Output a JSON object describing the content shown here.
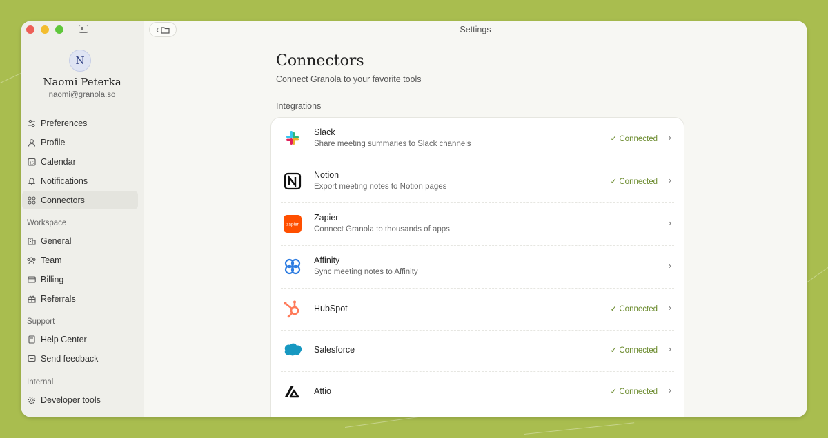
{
  "window": {
    "title": "Settings"
  },
  "user": {
    "initial": "N",
    "name": "Naomi Peterka",
    "email": "naomi@granola.so"
  },
  "sidebar": {
    "main_items": [
      {
        "label": "Preferences",
        "icon": "sliders-icon"
      },
      {
        "label": "Profile",
        "icon": "person-icon"
      },
      {
        "label": "Calendar",
        "icon": "calendar-icon"
      },
      {
        "label": "Notifications",
        "icon": "bell-icon"
      },
      {
        "label": "Connectors",
        "icon": "connectors-icon",
        "active": true
      }
    ],
    "workspace_label": "Workspace",
    "workspace_items": [
      {
        "label": "General",
        "icon": "building-icon"
      },
      {
        "label": "Team",
        "icon": "team-icon"
      },
      {
        "label": "Billing",
        "icon": "card-icon"
      },
      {
        "label": "Referrals",
        "icon": "gift-icon"
      }
    ],
    "support_label": "Support",
    "support_items": [
      {
        "label": "Help Center",
        "icon": "book-icon"
      },
      {
        "label": "Send feedback",
        "icon": "feedback-icon"
      }
    ],
    "internal_label": "Internal",
    "internal_items": [
      {
        "label": "Developer tools",
        "icon": "gear-icon"
      }
    ]
  },
  "page": {
    "title": "Connectors",
    "subtitle": "Connect Granola to your favorite tools",
    "section_label": "Integrations"
  },
  "integrations": [
    {
      "name": "Slack",
      "description": "Share meeting summaries to Slack channels",
      "status": "Connected",
      "icon": "slack-icon"
    },
    {
      "name": "Notion",
      "description": "Export meeting notes to Notion pages",
      "status": "Connected",
      "icon": "notion-icon"
    },
    {
      "name": "Zapier",
      "description": "Connect Granola to thousands of apps",
      "status": "",
      "icon": "zapier-icon"
    },
    {
      "name": "Affinity",
      "description": "Sync meeting notes to Affinity",
      "status": "",
      "icon": "affinity-icon"
    },
    {
      "name": "HubSpot",
      "description": "",
      "status": "Connected",
      "icon": "hubspot-icon"
    },
    {
      "name": "Salesforce",
      "description": "",
      "status": "Connected",
      "icon": "salesforce-icon"
    },
    {
      "name": "Attio",
      "description": "",
      "status": "Connected",
      "icon": "attio-icon"
    }
  ],
  "status_check": "✓",
  "chevron": "›",
  "colors": {
    "background": "#a9bd4f",
    "connected": "#6a8a2c",
    "zapier": "#ff4f00",
    "hubspot": "#ff7a59",
    "salesforce": "#1798c1",
    "affinity": "#2f7de1"
  }
}
